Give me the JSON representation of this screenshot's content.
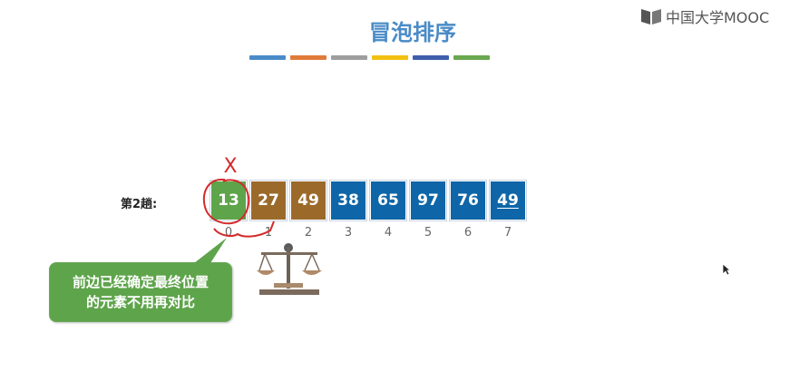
{
  "slide": {
    "logo_text": "中国大学MOOC",
    "title": "冒泡排序",
    "title_color": "#4a8bc7",
    "color_bar": [
      "#4a8bc7",
      "#e07b39",
      "#9e9e9e",
      "#f2c012",
      "#3f5fad",
      "#6aa84f"
    ],
    "pass_label": "第2趟:",
    "cells": [
      {
        "value": "13",
        "index": "0",
        "color": "#5ea44b"
      },
      {
        "value": "27",
        "index": "1",
        "color": "#9b6a2a"
      },
      {
        "value": "49",
        "index": "2",
        "color": "#9b6a2a"
      },
      {
        "value": "38",
        "index": "3",
        "color": "#0e66a8"
      },
      {
        "value": "65",
        "index": "4",
        "color": "#0e66a8"
      },
      {
        "value": "97",
        "index": "5",
        "color": "#0e66a8"
      },
      {
        "value": "76",
        "index": "6",
        "color": "#0e66a8"
      },
      {
        "value": "49",
        "index": "7",
        "color": "#0e66a8"
      }
    ],
    "annotation_mark": "X",
    "bubble_lines": [
      "前边已经确定最终位置",
      "的元素不用再对比"
    ],
    "annotation_color": "#d42a2a"
  }
}
